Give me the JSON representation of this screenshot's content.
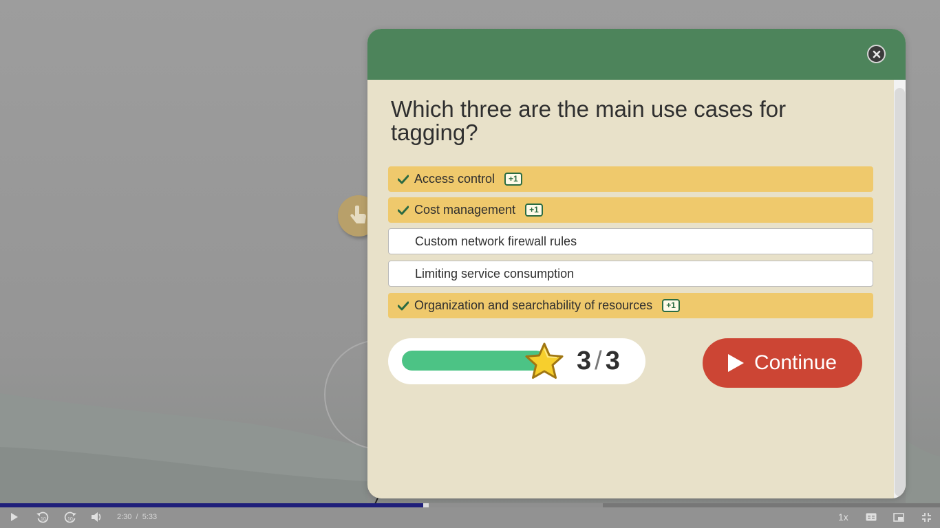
{
  "quiz": {
    "question": "Which three are the main use cases for tagging?",
    "answers": [
      {
        "label": "Access control",
        "correct": true,
        "badge": "+1"
      },
      {
        "label": "Cost management",
        "correct": true,
        "badge": "+1"
      },
      {
        "label": "Custom network firewall rules",
        "correct": false,
        "badge": ""
      },
      {
        "label": "Limiting service consumption",
        "correct": false,
        "badge": ""
      },
      {
        "label": "Organization and searchability of resources",
        "correct": true,
        "badge": "+1"
      }
    ],
    "score": {
      "earned": "3",
      "total": "3",
      "progress_fraction": 1.0
    },
    "continue_label": "Continue"
  },
  "player": {
    "current_time": "2:30",
    "time_separator": "/",
    "duration": "5:33",
    "playback_fraction": 0.45,
    "speed": "1x"
  },
  "icons": {
    "close": "close-icon",
    "check": "check-icon",
    "star": "star-icon",
    "play": "play-icon",
    "rewind": "rewind-10-icon",
    "forward": "forward-10-icon",
    "volume": "volume-icon",
    "captions": "captions-icon",
    "pip": "picture-in-picture-icon",
    "exit_fullscreen": "exit-fullscreen-icon"
  },
  "colors": {
    "header": "#4d845b",
    "modal_bg": "#e8e1c9",
    "correct_row": "#efc96c",
    "continue": "#cc4534",
    "score_fill": "#4cc385",
    "progress_played": "#1f1f7a"
  }
}
